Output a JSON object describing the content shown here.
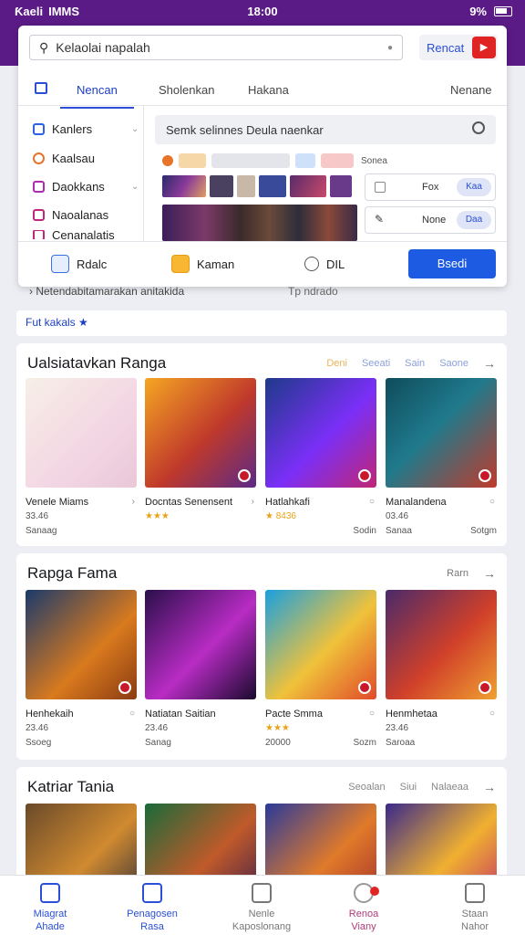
{
  "status_bar": {
    "carrier": "Ƙaeli",
    "network": "IMMS",
    "time": "18:00",
    "battery": "9%"
  },
  "search": {
    "value": "Kelaolai napalah",
    "button": "Rencat"
  },
  "tabs": [
    "Nencan",
    "Sholenkan",
    "Hakana",
    "Nenane"
  ],
  "sidebar": [
    "Kanlers",
    "Kaalsau",
    "Daokkans",
    "Naoalanas",
    "Cenanalatis"
  ],
  "mini_search": "Semk selinnes  Deula naenkar",
  "chip_label": "Sonea",
  "options": [
    {
      "label": "Fox",
      "toggle": "Kaa"
    },
    {
      "label": "None",
      "toggle": "Daa"
    }
  ],
  "panel_footer": {
    "item1": "Rdalc",
    "item2": "Kaman",
    "item3": "DIL",
    "primary": "Bsedi"
  },
  "below_panel": {
    "left": "Netendabitamarakan anitakida",
    "right": "Tp ndrado"
  },
  "filter": "Fut kakals ★",
  "sections": [
    {
      "title": "Ualsiatavkan Ranga",
      "links": [
        "Deni",
        "Seeati",
        "Sain",
        "Saone"
      ],
      "cards": [
        {
          "name": "Venele Miams",
          "meta": "33.46",
          "sub": "Sanaag",
          "subr": ""
        },
        {
          "name": "Docntas Senensent",
          "meta": "★★★",
          "sub": "",
          "subr": ""
        },
        {
          "name": "Hatlahkafi",
          "meta": "★ 8436",
          "sub": "",
          "subr": "Sodin"
        },
        {
          "name": "Manalandena",
          "meta": "03.46",
          "sub": "Sanaa",
          "subr": "Sotgm"
        }
      ]
    },
    {
      "title": "Rapga Fama",
      "links": [
        "Rarn"
      ],
      "cards": [
        {
          "name": "Henhekaih",
          "meta": "23.46",
          "sub": "Ssoeg",
          "subr": ""
        },
        {
          "name": "Natiatan Saitian",
          "meta": "23.46",
          "sub": "Sanag",
          "subr": ""
        },
        {
          "name": "Pacte Smma",
          "meta": "★★★",
          "sub": "20000",
          "subr": "Sozm"
        },
        {
          "name": "Henmhetaa",
          "meta": "23.46",
          "sub": "Saroaa",
          "subr": ""
        }
      ]
    },
    {
      "title": "Katriar Tania",
      "links": [
        "Seoalan",
        "Siui",
        "Nalaeaa"
      ],
      "cards": [
        {},
        {},
        {},
        {}
      ]
    }
  ],
  "bottom_nav": [
    {
      "l1": "Miagrat",
      "l2": "Ahade"
    },
    {
      "l1": "Penagosen",
      "l2": "Rasa"
    },
    {
      "l1": "Nenle",
      "l2": "Kaposlonang"
    },
    {
      "l1": "Renoa",
      "l2": "Viany"
    },
    {
      "l1": "Staan",
      "l2": "Nahor"
    }
  ],
  "colors": {
    "header": "#5a1b86",
    "accent": "#1d5be2",
    "alert": "#e02424"
  }
}
